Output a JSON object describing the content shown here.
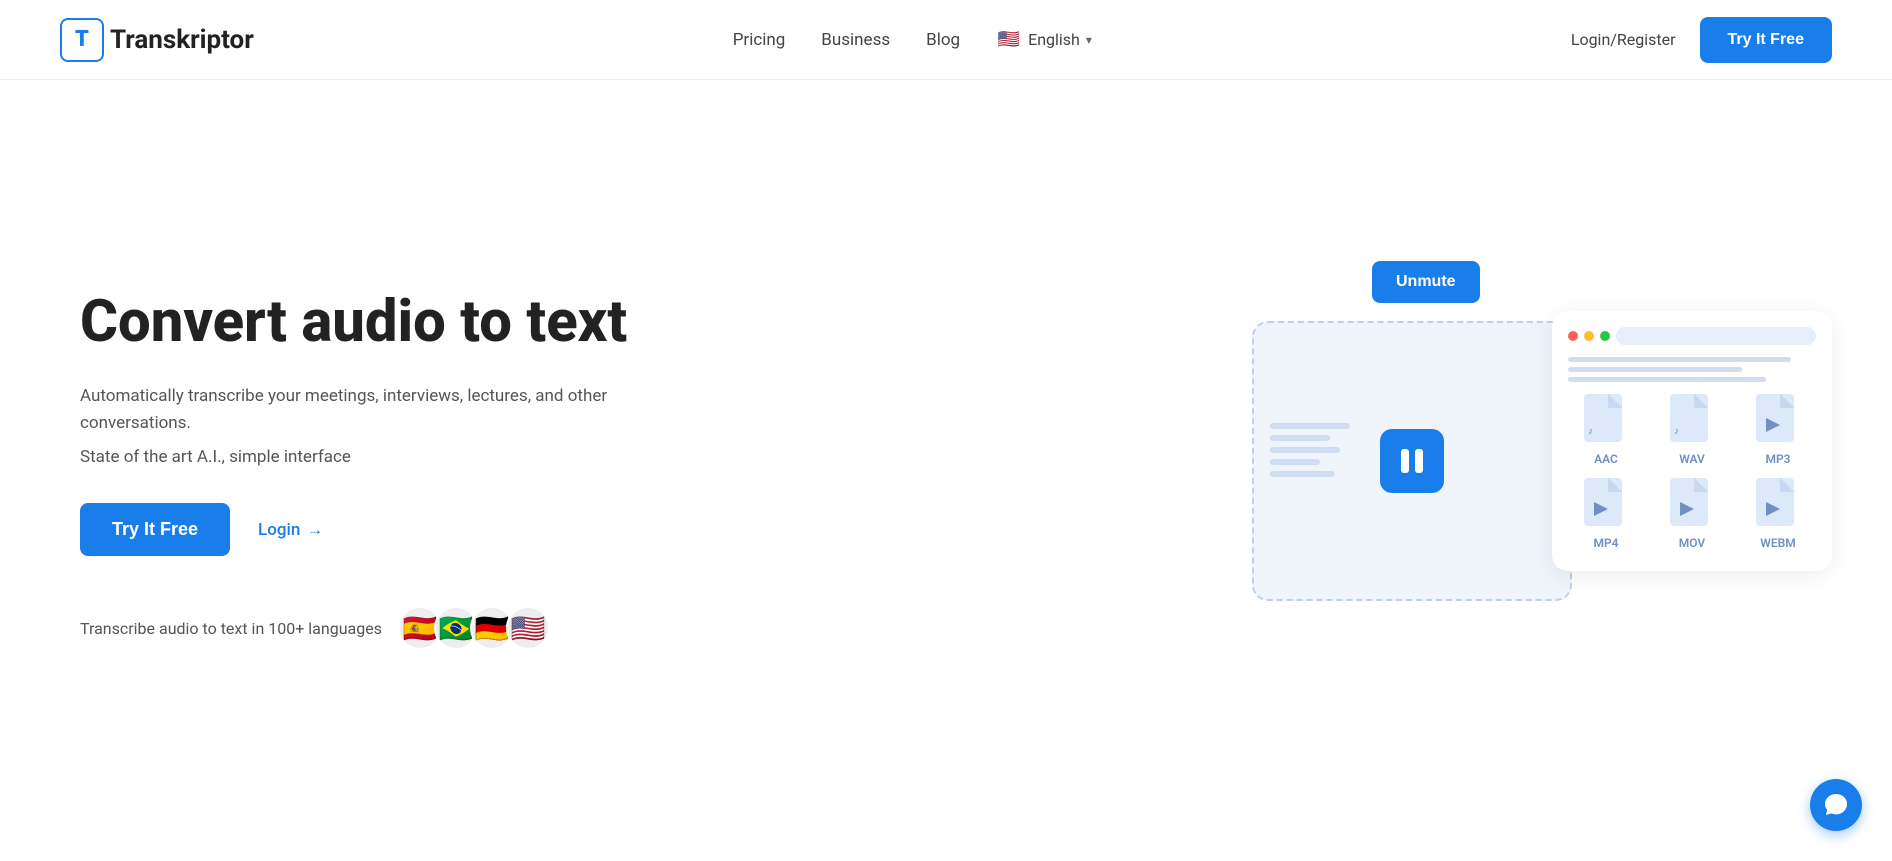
{
  "brand": {
    "logo_letter": "T",
    "name": "ranskriptor"
  },
  "navbar": {
    "links": [
      {
        "id": "pricing",
        "label": "Pricing"
      },
      {
        "id": "business",
        "label": "Business"
      },
      {
        "id": "blog",
        "label": "Blog"
      }
    ],
    "language": {
      "flag": "🇺🇸",
      "label": "English"
    },
    "login_label": "Login/Register",
    "cta_label": "Try It Free"
  },
  "hero": {
    "title": "Convert audio to text",
    "subtitle": "Automatically transcribe your meetings, interviews, lectures, and other conversations.",
    "tagline": "State of the art A.I., simple interface",
    "cta_label": "Try It Free",
    "login_label": "Login",
    "login_arrow": "→",
    "languages_text": "Transcribe audio to text in 100+ languages",
    "flags": [
      "🇪🇸",
      "🇧🇷",
      "🇩🇪",
      "🇺🇸"
    ]
  },
  "illustration": {
    "unmute_label": "Unmute",
    "formats": [
      {
        "label": "AAC",
        "type": "audio"
      },
      {
        "label": "WAV",
        "type": "audio"
      },
      {
        "label": "MP3",
        "type": "audio"
      },
      {
        "label": "MP4",
        "type": "video"
      },
      {
        "label": "MOV",
        "type": "video"
      },
      {
        "label": "WEBM",
        "type": "video"
      }
    ]
  },
  "colors": {
    "primary": "#1a7eea",
    "text_dark": "#222222",
    "text_mid": "#555555",
    "bg": "#ffffff",
    "format_icon_bg": "#dde8f8",
    "format_icon_color": "#7090c0"
  }
}
